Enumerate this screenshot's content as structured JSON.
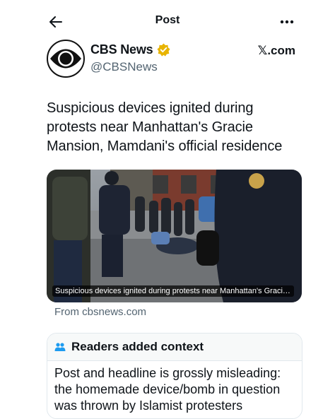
{
  "header": {
    "title": "Post",
    "back_icon": "arrow-left-icon",
    "more_icon": "more-horizontal-icon"
  },
  "author": {
    "name": "CBS News",
    "handle": "@CBSNews",
    "verified_color": "#e8b400",
    "source_label": "𝕏.com"
  },
  "post": {
    "text": "Suspicious devices ignited during protests near Manhattan's Gracie Mansion, Mamdani's official residence",
    "media_caption": "Suspicious devices ignited during protests near Manhattan's Gracie Mansion, Mamdani's official residence",
    "source": "From cbsnews.com"
  },
  "context": {
    "title": "Readers added context",
    "icon": "people-icon",
    "icon_color": "#1d9bf0",
    "body": "Post and headline is grossly misleading: the homemade device/bomb in question was thrown by Islamist protesters"
  }
}
